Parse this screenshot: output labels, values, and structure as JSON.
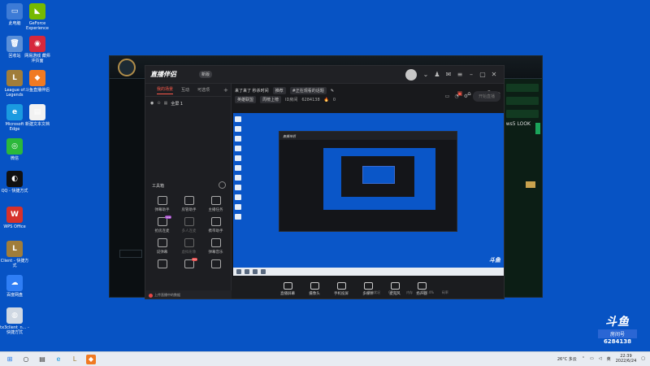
{
  "desktop": {
    "icons": [
      {
        "label": "此电脑",
        "glyph": "▭",
        "bg": "#3d7bd6"
      },
      {
        "label": "GeForce Experience",
        "glyph": "◣",
        "bg": "#76b900"
      },
      {
        "label": "回收站",
        "glyph": "🗑",
        "bg": "#5a8fd8"
      },
      {
        "label": "网易游戏 藏师 沖页面",
        "glyph": "◉",
        "bg": "#d6283c"
      },
      {
        "label": "League of Legends",
        "glyph": "L",
        "bg": "#a07d3a"
      },
      {
        "label": "斗鱼直播伴侣",
        "glyph": "◆",
        "bg": "#f07a22"
      },
      {
        "label": "Microsoft Edge",
        "glyph": "e",
        "bg": "#1a9ae0"
      },
      {
        "label": "新建文本文档",
        "glyph": "▤",
        "bg": "#f2f2f2"
      },
      {
        "label": "微信",
        "glyph": "◎",
        "bg": "#2bb83b"
      },
      {
        "label": "QQ - 快捷方式",
        "glyph": "◐",
        "bg": "#111"
      },
      {
        "label": "WPS Office",
        "glyph": "W",
        "bg": "#d6312b"
      },
      {
        "label": "Client - 快捷方式",
        "glyph": "L",
        "bg": "#a07d3a"
      },
      {
        "label": "百度网盘",
        "glyph": "☁",
        "bg": "#2f7ef5"
      },
      {
        "label": "tx3client_n... - 快捷方式",
        "glyph": "◍",
        "bg": "#cfd8e3"
      }
    ]
  },
  "game": {
    "look_label": "ws5 LOOK"
  },
  "app": {
    "logo": "直播伴侣",
    "version": "新版",
    "sidebar": {
      "tabs": [
        "我的场景",
        "互动",
        "可选项"
      ],
      "add": "+",
      "scene_name": "全屏 1",
      "tools_title": "工具箱",
      "tools": [
        {
          "label": "弹幕助手",
          "badge": ""
        },
        {
          "label": "房管助手",
          "badge": ""
        },
        {
          "label": "主播任务",
          "badge": ""
        },
        {
          "label": "抢房连麦",
          "badge": "new"
        },
        {
          "label": "多人连麦",
          "badge": "",
          "dim": true
        },
        {
          "label": "携带助手",
          "badge": ""
        },
        {
          "label": "说弹幕",
          "badge": ""
        },
        {
          "label": "虚拟形象",
          "badge": "",
          "dim": true
        },
        {
          "label": "弹幕音乐",
          "badge": ""
        },
        {
          "label": "",
          "badge": ""
        },
        {
          "label": "",
          "badge": "hot"
        },
        {
          "label": "",
          "badge": ""
        }
      ],
      "footer": "上传直播中的数据"
    },
    "content": {
      "title": "来了来了 秒杀时间",
      "chip_1": "推荐",
      "chip_2": "#正在观看的话题",
      "category": "英雄联盟",
      "sub_category": "周榜上榜",
      "room_id_label": "ID房间",
      "room_id": "6284138",
      "online": "0",
      "preview_logo": "斗鱼",
      "controls": [
        {
          "label": "直播屏幕"
        },
        {
          "label": "摄像头"
        },
        {
          "label": "手机投屏"
        },
        {
          "label": "多媒体"
        },
        {
          "label": "麦克风"
        },
        {
          "label": "扬声器"
        }
      ],
      "start_button": "开始直播"
    }
  },
  "stats": [
    "网络状况",
    "CPU占",
    "内存",
    "CPU 4%",
    "码率"
  ],
  "watermark": {
    "logo": "斗鱼",
    "room_label": "房间号",
    "room_id": "6284138"
  },
  "taskbar": {
    "weather": "26°C 多云",
    "lang": "英",
    "time": "22:39",
    "date": "2022/6/24"
  }
}
